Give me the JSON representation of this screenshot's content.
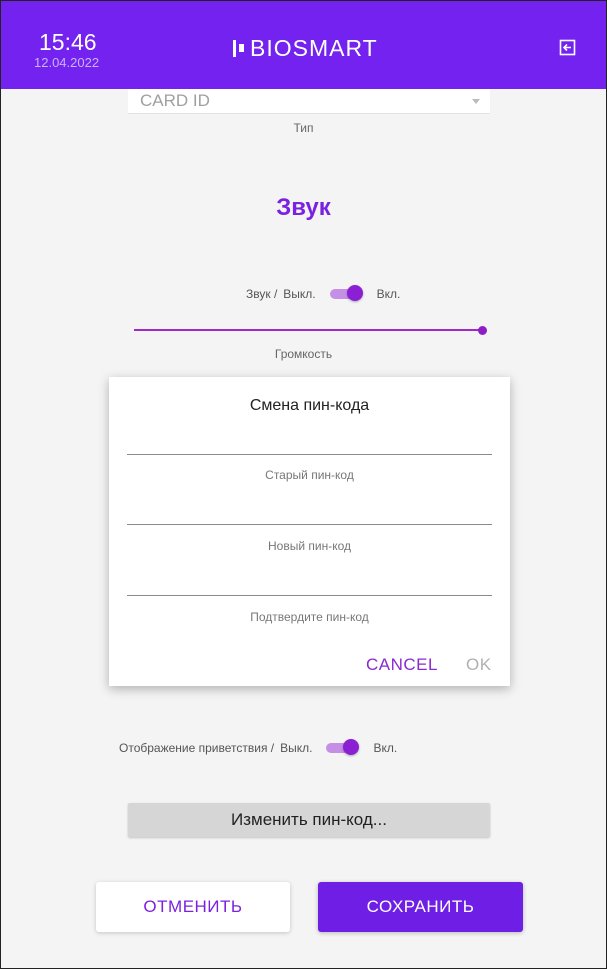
{
  "header": {
    "time": "15:46",
    "date": "12.04.2022",
    "logo": "BIOSMART",
    "exit_icon": "exit-icon"
  },
  "card_type": {
    "selected": "CARD ID",
    "label": "Тип"
  },
  "sound_section": {
    "title": "Звук",
    "toggle": {
      "label": "Звук /",
      "off": "Выкл.",
      "on": "Вкл.",
      "enabled": true
    },
    "volume": {
      "label": "Громкость",
      "level": 1.0
    }
  },
  "pin_dialog": {
    "title": "Смена пин-кода",
    "fields": [
      {
        "label": "Старый пин-код",
        "value": ""
      },
      {
        "label": "Новый пин-код",
        "value": ""
      },
      {
        "label": "Подтвердите пин-код",
        "value": ""
      }
    ],
    "cancel": "CANCEL",
    "ok": "OK"
  },
  "greeting": {
    "label": "Отображение приветствия /",
    "off": "Выкл.",
    "on": "Вкл.",
    "enabled": true
  },
  "change_pin_button": "Изменить пин-код...",
  "footer": {
    "cancel": "ОТМЕНИТЬ",
    "save": "СОХРАНИТЬ"
  },
  "colors": {
    "brand": "#7422f0",
    "accent": "#8a1fd4",
    "save_button": "#6f1ee6"
  }
}
